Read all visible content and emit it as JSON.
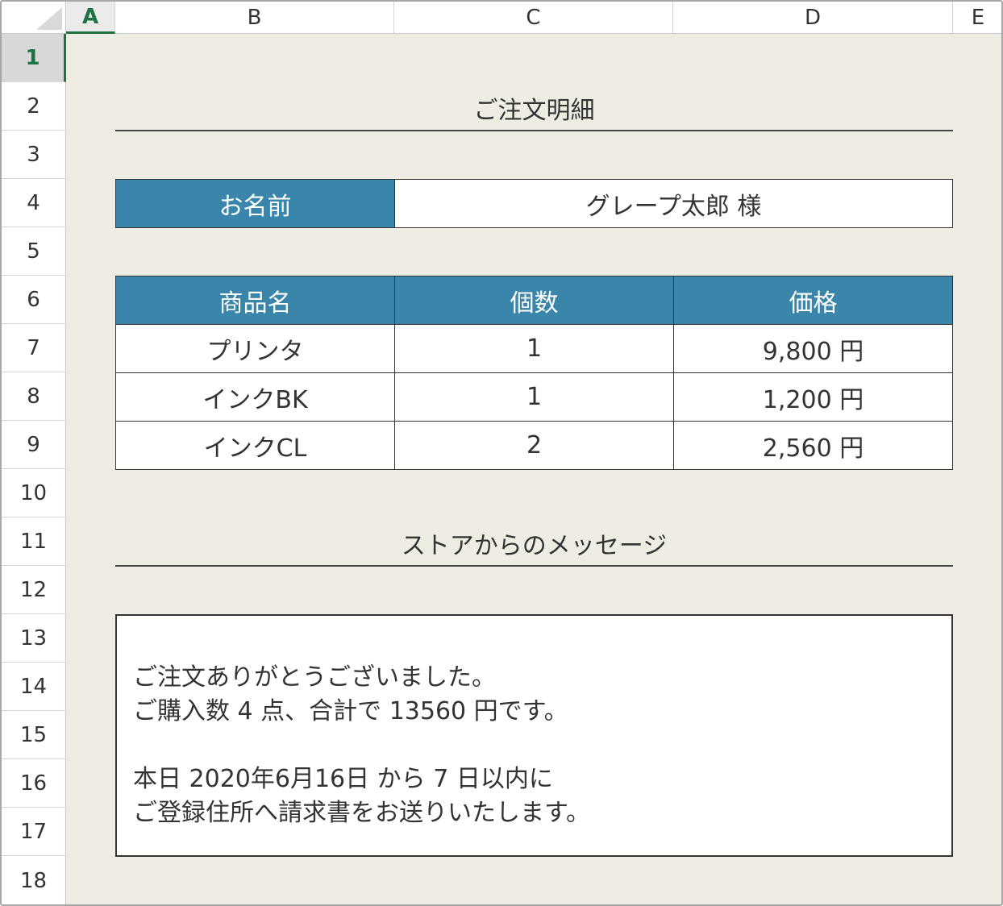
{
  "headers": {
    "columns": [
      "A",
      "B",
      "C",
      "D",
      "E"
    ],
    "rows": [
      "1",
      "2",
      "3",
      "4",
      "5",
      "6",
      "7",
      "8",
      "9",
      "10",
      "11",
      "12",
      "13",
      "14",
      "15",
      "16",
      "17",
      "18"
    ],
    "active_column": "A",
    "active_row": "1"
  },
  "title": "ご注文明細",
  "name_row": {
    "label": "お名前",
    "value": "グレープ太郎 様"
  },
  "orders": {
    "headers": [
      "商品名",
      "個数",
      "価格"
    ],
    "rows": [
      [
        "プリンタ",
        "1",
        "9,800 円"
      ],
      [
        "インクBK",
        "1",
        "1,200 円"
      ],
      [
        "インクCL",
        "2",
        "2,560 円"
      ]
    ]
  },
  "message_title": "ストアからのメッセージ",
  "message": {
    "line1": "ご注文ありがとうございました。",
    "line2": "ご購入数 4 点、合計で 13560 円です。",
    "line3": "本日 2020年6月16日 から 7 日以内に",
    "line4": "ご登録住所へ請求書をお送りいたします。"
  },
  "colors": {
    "header_fill": "#3a86ab",
    "sheet_background": "#efede3",
    "active_header": "#1f7244"
  }
}
